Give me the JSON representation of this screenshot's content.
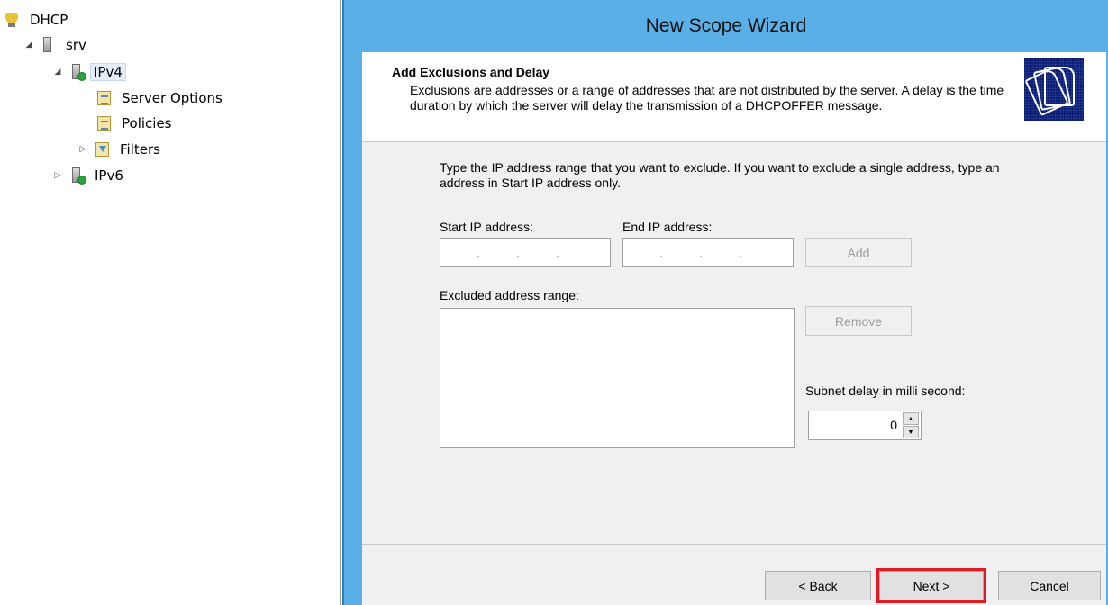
{
  "tree": {
    "root": "DHCP",
    "server": "srv",
    "ipv4": "IPv4",
    "server_options": "Server Options",
    "policies": "Policies",
    "filters": "Filters",
    "ipv6": "IPv6"
  },
  "wizard": {
    "title": "New Scope Wizard",
    "step_title": "Add Exclusions and Delay",
    "step_description": "Exclusions are addresses or a range of addresses that are not distributed by the server. A delay is the time duration by which the server will delay the transmission of a DHCPOFFER message.",
    "instructions": "Type the IP address range that you want to exclude. If you want to exclude a single address, type an address in Start IP address only.",
    "start_ip_label": "Start IP address:",
    "end_ip_label": "End IP address:",
    "ip_dot": ".",
    "add_label": "Add",
    "excluded_label": "Excluded address range:",
    "remove_label": "Remove",
    "delay_label": "Subnet delay in milli second:",
    "delay_value": "0",
    "back_label": "< Back",
    "next_label": "Next >",
    "cancel_label": "Cancel"
  },
  "colors": {
    "title_bar": "#5ab0e6",
    "highlight": "#e01b24"
  }
}
